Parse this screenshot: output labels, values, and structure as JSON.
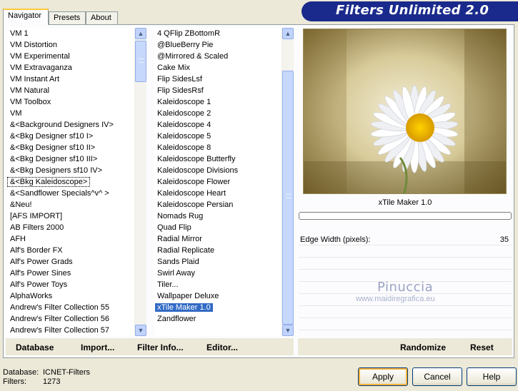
{
  "tabs": [
    "Navigator",
    "Presets",
    "About"
  ],
  "title": "Filters Unlimited 2.0",
  "categories": [
    "VM 1",
    "VM Distortion",
    "VM Experimental",
    "VM Extravaganza",
    "VM Instant Art",
    "VM Natural",
    "VM Toolbox",
    "VM",
    "&<Background Designers IV>",
    "&<Bkg Designer sf10 I>",
    "&<Bkg Designer sf10 II>",
    "&<Bkg Designer sf10 III>",
    "&<Bkg Designers sf10 IV>",
    "&<Bkg Kaleidoscope>",
    "&<Sandflower Specials^v^ >",
    "&Neu!",
    "[AFS IMPORT]",
    "AB Filters 2000",
    "AFH",
    "Alf's Border FX",
    "Alf's Power Grads",
    "Alf's Power Sines",
    "Alf's Power Toys",
    "AlphaWorks",
    "Andrew's Filter Collection 55",
    "Andrew's Filter Collection 56",
    "Andrew's Filter Collection 57"
  ],
  "selected_category_index": 13,
  "filters": [
    "4 QFlip ZBottomR",
    "@BlueBerry Pie",
    "@Mirrored & Scaled",
    "Cake Mix",
    "Flip SidesLsf",
    "Flip SidesRsf",
    "Kaleidoscope 1",
    "Kaleidoscope 2",
    "Kaleidoscope 4",
    "Kaleidoscope 5",
    "Kaleidoscope 8",
    "Kaleidoscope Butterfly",
    "Kaleidoscope Divisions",
    "Kaleidoscope Flower",
    "Kaleidoscope Heart",
    "Kaleidoscope Persian",
    "Nomads Rug",
    "Quad Flip",
    "Radial Mirror",
    "Radial Replicate",
    "Sands Plaid",
    "Swirl Away",
    "Tiler...",
    "Wallpaper Deluxe",
    "xTile Maker 1.0",
    "Zandflower"
  ],
  "selected_filter_index": 24,
  "left_buttons": [
    "Database",
    "Import...",
    "Filter Info...",
    "Editor..."
  ],
  "right_buttons": [
    "Randomize",
    "Reset"
  ],
  "filter_name": "xTile Maker 1.0",
  "params": [
    {
      "label": "Edge Width (pixels):",
      "value": "35"
    }
  ],
  "watermark": {
    "name": "Pinuccia",
    "url": "www.maidiregrafica.eu"
  },
  "footer": {
    "database_label": "Database:",
    "database_value": "ICNET-Filters",
    "filters_label": "Filters:",
    "filters_value": "1273"
  },
  "dialog_buttons": {
    "apply": "Apply",
    "cancel": "Cancel",
    "help": "Help"
  },
  "colors": {
    "selection": "#316ac5",
    "banner": "#1a2a8c",
    "default_button_ring": "#f8b33c"
  }
}
